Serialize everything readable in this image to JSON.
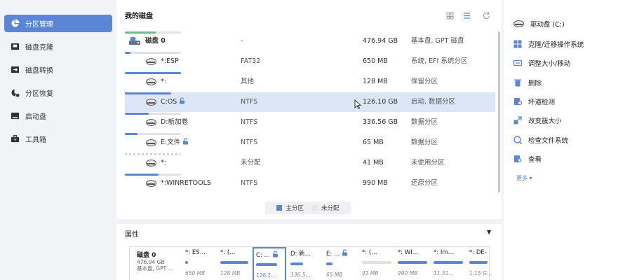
{
  "colors": {
    "accent": "#5b86d6",
    "system_bar": "#6abf8e",
    "selected_row": "#dbe6f7"
  },
  "sidebar": {
    "items": [
      {
        "label": "分区管理",
        "icon": "pie-chart-icon",
        "active": true
      },
      {
        "label": "磁盘克隆",
        "icon": "disk-clone-icon",
        "active": false
      },
      {
        "label": "磁盘转换",
        "icon": "disk-convert-icon",
        "active": false
      },
      {
        "label": "分区恢复",
        "icon": "partition-recovery-icon",
        "active": false
      },
      {
        "label": "启动盘",
        "icon": "boot-disk-icon",
        "active": false
      },
      {
        "label": "工具箱",
        "icon": "toolbox-icon",
        "active": false
      }
    ]
  },
  "main": {
    "title": "我的磁盘",
    "toolbar": [
      "grid-view-icon",
      "list-view-icon",
      "refresh-icon"
    ],
    "rows": [
      {
        "name": "磁盘 0",
        "fs": "-",
        "fill": 0.55,
        "size": "476.94 GB",
        "type": "基本盘, GPT 磁盘",
        "disk": true,
        "locked": false,
        "unalloc": false
      },
      {
        "name": "*:ESP",
        "fs": "FAT32",
        "fill": 0.1,
        "size": "650 MB",
        "type": "系统, EFI 系统分区",
        "disk": false,
        "locked": false,
        "unalloc": false
      },
      {
        "name": "*:",
        "fs": "其他",
        "fill": 1.0,
        "size": "128 MB",
        "type": "保留分区",
        "disk": false,
        "locked": false,
        "unalloc": false
      },
      {
        "name": "C:OS",
        "fs": "NTFS",
        "fill": 0.82,
        "size": "126.10 GB",
        "type": "启动, 数据分区",
        "disk": false,
        "locked": true,
        "unalloc": false,
        "selected": true
      },
      {
        "name": "D:新加卷",
        "fs": "NTFS",
        "fill": 0.42,
        "size": "336.56 GB",
        "type": "数据分区",
        "disk": false,
        "locked": false,
        "unalloc": false
      },
      {
        "name": "E:文件",
        "fs": "NTFS",
        "fill": 0.22,
        "size": "65 MB",
        "type": "数据分区",
        "disk": false,
        "locked": true,
        "unalloc": false
      },
      {
        "name": "*:",
        "fs": "未分配",
        "fill": 0,
        "size": "41 MB",
        "type": "未使用分区",
        "disk": false,
        "locked": false,
        "unalloc": true
      },
      {
        "name": "*:WINRETOOLS",
        "fs": "NTFS",
        "fill": 0.6,
        "size": "990 MB",
        "type": "还原分区",
        "disk": false,
        "locked": false,
        "unalloc": false
      }
    ],
    "legend": {
      "primary": "主分区",
      "unallocated": "未分配"
    }
  },
  "properties": {
    "title": "属性",
    "disk": {
      "name": "磁盘 0",
      "size": "476.94 GB",
      "type": "基本盘, GPT …"
    },
    "parts": [
      {
        "name": "*: ES…",
        "size": "650 MB",
        "locked": false,
        "selected": false
      },
      {
        "name": "*: (…",
        "size": "128 MB",
        "locked": false,
        "selected": false
      },
      {
        "name": "C: …",
        "size": "126.1…",
        "locked": true,
        "selected": true
      },
      {
        "name": "D: 新…",
        "size": "336.5…",
        "locked": false,
        "selected": false
      },
      {
        "name": "E: …",
        "size": "65 MB",
        "locked": true,
        "selected": false
      },
      {
        "name": "*: (…",
        "size": "41 MB",
        "locked": false,
        "selected": false
      },
      {
        "name": "*: WI…",
        "size": "990 MB",
        "locked": false,
        "selected": false
      },
      {
        "name": "*: Im…",
        "size": "11.31…",
        "locked": false,
        "selected": false
      },
      {
        "name": "*: DE-",
        "size": "1.15 G…",
        "locked": false,
        "selected": false
      }
    ]
  },
  "right": {
    "items": [
      {
        "label": "驱动盘 (C:)",
        "icon": "drive-icon"
      },
      {
        "label": "克隆/迁移操作系统",
        "icon": "windows-icon"
      },
      {
        "label": "调整大小/移动",
        "icon": "resize-icon"
      },
      {
        "label": "删除",
        "icon": "trash-icon"
      },
      {
        "label": "坏道检测",
        "icon": "surface-test-icon"
      },
      {
        "label": "改变簇大小",
        "icon": "cluster-size-icon"
      },
      {
        "label": "检查文件系统",
        "icon": "check-fs-icon"
      },
      {
        "label": "查看",
        "icon": "view-icon"
      }
    ],
    "more": "更多 ▾"
  }
}
